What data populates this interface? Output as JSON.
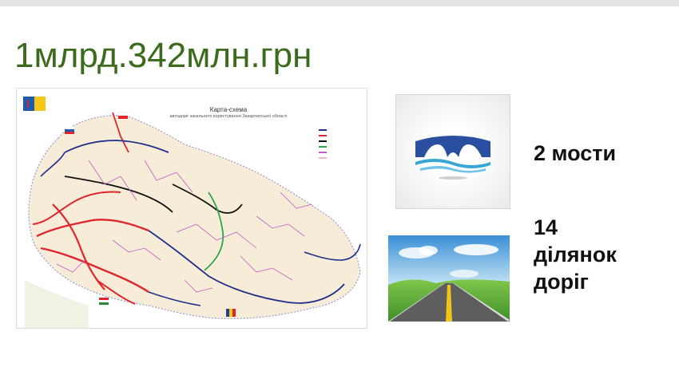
{
  "slide": {
    "title": "1млрд.342млн.грн"
  },
  "map": {
    "title": "Карта-схема",
    "subtitle": "автодоріг загального користування Закарпатської області",
    "legend_colors": [
      "#1f2f8c",
      "#e0242c",
      "#111111",
      "#2aa84a",
      "#c45ac8",
      "#f2b8b8"
    ]
  },
  "items": [
    {
      "icon": "bridge-icon",
      "label": "2 мости"
    },
    {
      "icon": "road-icon",
      "label_lines": [
        "14",
        "ділянок",
        "доріг"
      ]
    }
  ],
  "colors": {
    "title": "#3d6b1e",
    "bridge_blue": "#2a4fa0",
    "water": "#39a7d4"
  }
}
